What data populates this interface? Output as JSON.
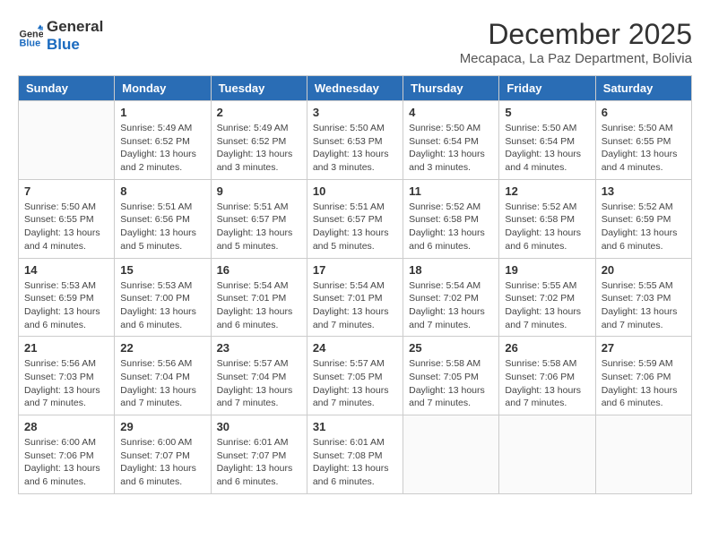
{
  "header": {
    "logo_line1": "General",
    "logo_line2": "Blue",
    "month": "December 2025",
    "location": "Mecapaca, La Paz Department, Bolivia"
  },
  "weekdays": [
    "Sunday",
    "Monday",
    "Tuesday",
    "Wednesday",
    "Thursday",
    "Friday",
    "Saturday"
  ],
  "weeks": [
    [
      {
        "day": "",
        "info": ""
      },
      {
        "day": "1",
        "info": "Sunrise: 5:49 AM\nSunset: 6:52 PM\nDaylight: 13 hours\nand 2 minutes."
      },
      {
        "day": "2",
        "info": "Sunrise: 5:49 AM\nSunset: 6:52 PM\nDaylight: 13 hours\nand 3 minutes."
      },
      {
        "day": "3",
        "info": "Sunrise: 5:50 AM\nSunset: 6:53 PM\nDaylight: 13 hours\nand 3 minutes."
      },
      {
        "day": "4",
        "info": "Sunrise: 5:50 AM\nSunset: 6:54 PM\nDaylight: 13 hours\nand 3 minutes."
      },
      {
        "day": "5",
        "info": "Sunrise: 5:50 AM\nSunset: 6:54 PM\nDaylight: 13 hours\nand 4 minutes."
      },
      {
        "day": "6",
        "info": "Sunrise: 5:50 AM\nSunset: 6:55 PM\nDaylight: 13 hours\nand 4 minutes."
      }
    ],
    [
      {
        "day": "7",
        "info": "Sunrise: 5:50 AM\nSunset: 6:55 PM\nDaylight: 13 hours\nand 4 minutes."
      },
      {
        "day": "8",
        "info": "Sunrise: 5:51 AM\nSunset: 6:56 PM\nDaylight: 13 hours\nand 5 minutes."
      },
      {
        "day": "9",
        "info": "Sunrise: 5:51 AM\nSunset: 6:57 PM\nDaylight: 13 hours\nand 5 minutes."
      },
      {
        "day": "10",
        "info": "Sunrise: 5:51 AM\nSunset: 6:57 PM\nDaylight: 13 hours\nand 5 minutes."
      },
      {
        "day": "11",
        "info": "Sunrise: 5:52 AM\nSunset: 6:58 PM\nDaylight: 13 hours\nand 6 minutes."
      },
      {
        "day": "12",
        "info": "Sunrise: 5:52 AM\nSunset: 6:58 PM\nDaylight: 13 hours\nand 6 minutes."
      },
      {
        "day": "13",
        "info": "Sunrise: 5:52 AM\nSunset: 6:59 PM\nDaylight: 13 hours\nand 6 minutes."
      }
    ],
    [
      {
        "day": "14",
        "info": "Sunrise: 5:53 AM\nSunset: 6:59 PM\nDaylight: 13 hours\nand 6 minutes."
      },
      {
        "day": "15",
        "info": "Sunrise: 5:53 AM\nSunset: 7:00 PM\nDaylight: 13 hours\nand 6 minutes."
      },
      {
        "day": "16",
        "info": "Sunrise: 5:54 AM\nSunset: 7:01 PM\nDaylight: 13 hours\nand 6 minutes."
      },
      {
        "day": "17",
        "info": "Sunrise: 5:54 AM\nSunset: 7:01 PM\nDaylight: 13 hours\nand 7 minutes."
      },
      {
        "day": "18",
        "info": "Sunrise: 5:54 AM\nSunset: 7:02 PM\nDaylight: 13 hours\nand 7 minutes."
      },
      {
        "day": "19",
        "info": "Sunrise: 5:55 AM\nSunset: 7:02 PM\nDaylight: 13 hours\nand 7 minutes."
      },
      {
        "day": "20",
        "info": "Sunrise: 5:55 AM\nSunset: 7:03 PM\nDaylight: 13 hours\nand 7 minutes."
      }
    ],
    [
      {
        "day": "21",
        "info": "Sunrise: 5:56 AM\nSunset: 7:03 PM\nDaylight: 13 hours\nand 7 minutes."
      },
      {
        "day": "22",
        "info": "Sunrise: 5:56 AM\nSunset: 7:04 PM\nDaylight: 13 hours\nand 7 minutes."
      },
      {
        "day": "23",
        "info": "Sunrise: 5:57 AM\nSunset: 7:04 PM\nDaylight: 13 hours\nand 7 minutes."
      },
      {
        "day": "24",
        "info": "Sunrise: 5:57 AM\nSunset: 7:05 PM\nDaylight: 13 hours\nand 7 minutes."
      },
      {
        "day": "25",
        "info": "Sunrise: 5:58 AM\nSunset: 7:05 PM\nDaylight: 13 hours\nand 7 minutes."
      },
      {
        "day": "26",
        "info": "Sunrise: 5:58 AM\nSunset: 7:06 PM\nDaylight: 13 hours\nand 7 minutes."
      },
      {
        "day": "27",
        "info": "Sunrise: 5:59 AM\nSunset: 7:06 PM\nDaylight: 13 hours\nand 6 minutes."
      }
    ],
    [
      {
        "day": "28",
        "info": "Sunrise: 6:00 AM\nSunset: 7:06 PM\nDaylight: 13 hours\nand 6 minutes."
      },
      {
        "day": "29",
        "info": "Sunrise: 6:00 AM\nSunset: 7:07 PM\nDaylight: 13 hours\nand 6 minutes."
      },
      {
        "day": "30",
        "info": "Sunrise: 6:01 AM\nSunset: 7:07 PM\nDaylight: 13 hours\nand 6 minutes."
      },
      {
        "day": "31",
        "info": "Sunrise: 6:01 AM\nSunset: 7:08 PM\nDaylight: 13 hours\nand 6 minutes."
      },
      {
        "day": "",
        "info": ""
      },
      {
        "day": "",
        "info": ""
      },
      {
        "day": "",
        "info": ""
      }
    ]
  ]
}
